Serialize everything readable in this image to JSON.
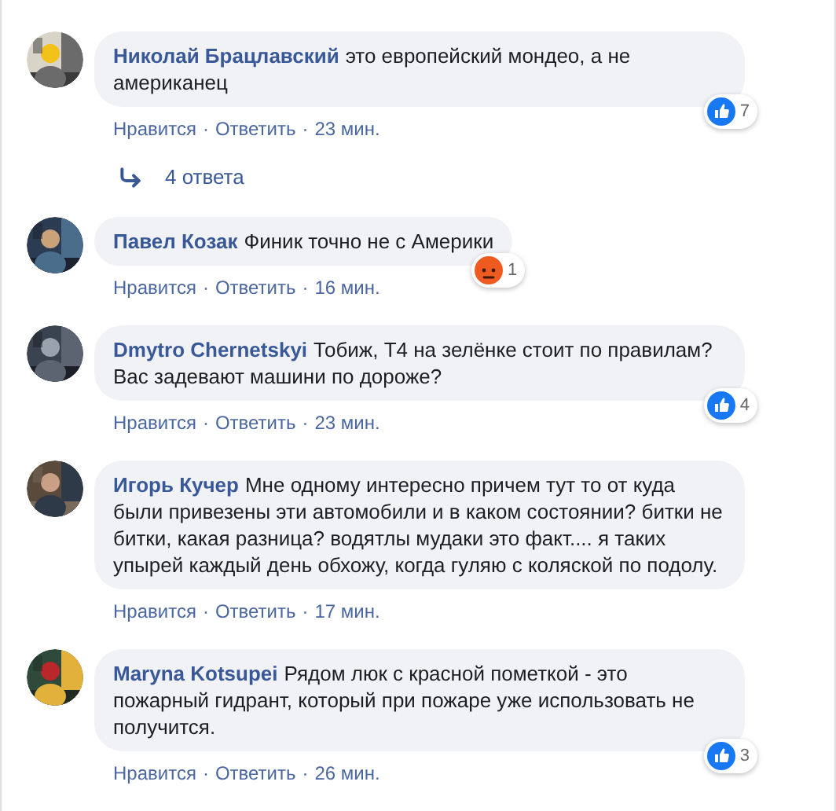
{
  "separator": "·",
  "comments": [
    {
      "author": "Николай Брацлавский",
      "text": "это европейский мондео, а не американец",
      "actions": [
        "Нравится",
        "Ответить"
      ],
      "time": "23 мин.",
      "reaction": {
        "kind": "like",
        "count": "7"
      },
      "replies": "4 ответа"
    },
    {
      "author": "Павел Козак",
      "text": "Финик точно не с Америки",
      "actions": [
        "Нравится",
        "Ответить"
      ],
      "time": "16 мин.",
      "reaction": {
        "kind": "angry",
        "count": "1"
      }
    },
    {
      "author": "Dmytro Chernetskyi",
      "text": "Тобиж, Т4 на зелёнке стоит по правилам? Вас задевают машини по дороже?",
      "actions": [
        "Нравится",
        "Ответить"
      ],
      "time": "23 мин.",
      "reaction": {
        "kind": "like",
        "count": "4"
      }
    },
    {
      "author": "Игорь Кучер",
      "text": "Мне одному интересно причем тут то от куда были привезены эти автомобили и в каком состоянии? битки не битки, какая разница? водятлы мудаки это факт.... я таких упырей каждый день обхожу, когда гуляю с коляской по подолу.",
      "actions": [
        "Нравится",
        "Ответить"
      ],
      "time": "17 мин."
    },
    {
      "author": "Maryna Kotsupei",
      "text": "Рядом люк с красной пометкой - это пожарный гидрант, который при пожаре уже использовать не получится.",
      "actions": [
        "Нравится",
        "Ответить"
      ],
      "time": "26 мин.",
      "reaction": {
        "kind": "like",
        "count": "3"
      }
    }
  ]
}
